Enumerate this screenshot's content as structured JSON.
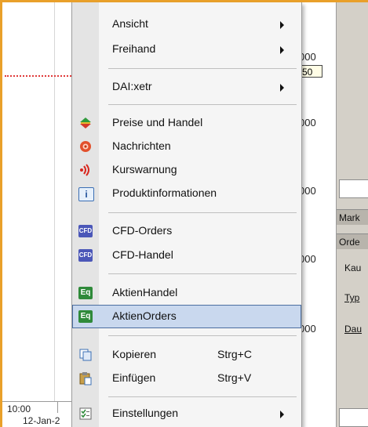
{
  "chart": {
    "price_labels": [
      "000",
      "000",
      "000",
      "000",
      "000"
    ],
    "price_box": "50",
    "axis_time": "10:00",
    "axis_date": "12-Jan-2"
  },
  "right_panel": {
    "strips": [
      "Mark",
      "Orde"
    ],
    "fields": [
      "Kau",
      "Typ",
      "Dau"
    ]
  },
  "menu": {
    "items": [
      {
        "label": "Ansicht",
        "icon": "none",
        "submenu": true
      },
      {
        "label": "Freihand",
        "icon": "none",
        "submenu": true
      },
      {
        "label": "DAI:xetr",
        "icon": "none",
        "submenu": true
      },
      {
        "label": "Preise und Handel",
        "icon": "price-trade-icon",
        "submenu": false
      },
      {
        "label": "Nachrichten",
        "icon": "news-icon",
        "submenu": false
      },
      {
        "label": "Kurswarnung",
        "icon": "alert-icon",
        "submenu": false
      },
      {
        "label": "Produktinformationen",
        "icon": "info-icon",
        "submenu": false
      },
      {
        "label": "CFD-Orders",
        "icon": "cfd-icon",
        "badge": "CFD",
        "submenu": false
      },
      {
        "label": "CFD-Handel",
        "icon": "cfd-icon",
        "badge": "CFD",
        "submenu": false
      },
      {
        "label": "AktienHandel",
        "icon": "eq-icon",
        "badge": "Eq",
        "submenu": false
      },
      {
        "label": "AktienOrders",
        "icon": "eq-icon",
        "badge": "Eq",
        "submenu": false,
        "highlighted": true
      },
      {
        "label": "Kopieren",
        "shortcut": "Strg+C",
        "icon": "copy-icon",
        "submenu": false
      },
      {
        "label": "Einfügen",
        "shortcut": "Strg+V",
        "icon": "paste-icon",
        "submenu": false
      },
      {
        "label": "Einstellungen",
        "icon": "settings-icon",
        "submenu": true
      }
    ]
  },
  "colors": {
    "frame": "#e9a02a",
    "highlight": "#c9d8ee",
    "highlight_border": "#4b6ea0"
  }
}
